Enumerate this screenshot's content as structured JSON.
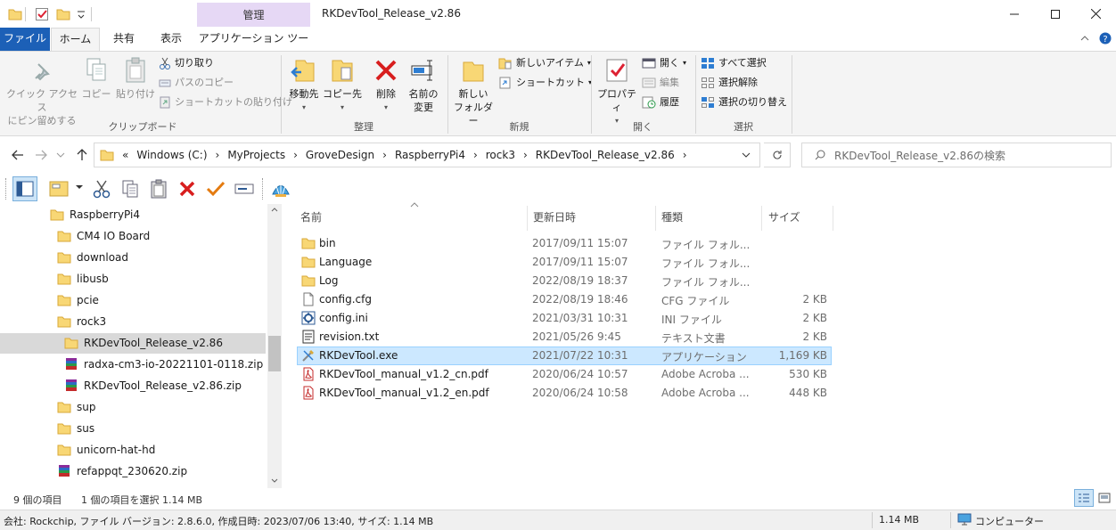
{
  "window": {
    "title": "RKDevTool_Release_v2.86",
    "context_tab_group": "管理"
  },
  "ribbon_tabs": [
    {
      "label": "ファイル"
    },
    {
      "label": "ホーム"
    },
    {
      "label": "共有"
    },
    {
      "label": "表示"
    },
    {
      "label": "アプリケーション ツール"
    }
  ],
  "ribbon": {
    "clipboard": {
      "label": "クリップボード",
      "pin_line1": "クイック アクセス",
      "pin_line2": "にピン留めする",
      "copy": "コピー",
      "paste": "貼り付け",
      "cut": "切り取り",
      "copy_path": "パスのコピー",
      "paste_shortcut": "ショートカットの貼り付け"
    },
    "organize": {
      "label": "整理",
      "move_to": "移動先",
      "copy_to": "コピー先",
      "delete": "削除",
      "rename_line1": "名前の",
      "rename_line2": "変更"
    },
    "new": {
      "label": "新規",
      "new_folder_line1": "新しい",
      "new_folder_line2": "フォルダー",
      "new_item": "新しいアイテム",
      "shortcut": "ショートカット"
    },
    "open": {
      "label": "開く",
      "properties": "プロパティ",
      "open": "開く",
      "edit": "編集",
      "history": "履歴"
    },
    "select": {
      "label": "選択",
      "select_all": "すべて選択",
      "select_none": "選択解除",
      "invert": "選択の切り替え"
    }
  },
  "address": {
    "prefix": "«",
    "crumbs": [
      "Windows (C:)",
      "MyProjects",
      "GroveDesign",
      "RaspberryPi4",
      "rock3",
      "RKDevTool_Release_v2.86"
    ],
    "search_placeholder": "RKDevTool_Release_v2.86の検索"
  },
  "tree": [
    {
      "label": "RaspberryPi4",
      "icon": "folder"
    },
    {
      "label": "CM4 IO Board",
      "icon": "folder"
    },
    {
      "label": "download",
      "icon": "folder"
    },
    {
      "label": "libusb",
      "icon": "folder"
    },
    {
      "label": "pcie",
      "icon": "folder"
    },
    {
      "label": "rock3",
      "icon": "folder"
    },
    {
      "label": "RKDevTool_Release_v2.86",
      "icon": "folder",
      "selected": true
    },
    {
      "label": "radxa-cm3-io-20221101-0118.zip",
      "icon": "archive"
    },
    {
      "label": "RKDevTool_Release_v2.86.zip",
      "icon": "archive"
    },
    {
      "label": "sup",
      "icon": "folder"
    },
    {
      "label": "sus",
      "icon": "folder"
    },
    {
      "label": "unicorn-hat-hd",
      "icon": "folder"
    },
    {
      "label": "refappqt_230620.zip",
      "icon": "archive"
    }
  ],
  "columns": {
    "name": "名前",
    "date": "更新日時",
    "type": "種類",
    "size": "サイズ"
  },
  "files": [
    {
      "name": "bin",
      "date": "2017/09/11 15:07",
      "type": "ファイル フォル...",
      "size": "",
      "icon": "folder"
    },
    {
      "name": "Language",
      "date": "2017/09/11 15:07",
      "type": "ファイル フォル...",
      "size": "",
      "icon": "folder"
    },
    {
      "name": "Log",
      "date": "2022/08/19 18:37",
      "type": "ファイル フォル...",
      "size": "",
      "icon": "folder"
    },
    {
      "name": "config.cfg",
      "date": "2022/08/19 18:46",
      "type": "CFG ファイル",
      "size": "2 KB",
      "icon": "file"
    },
    {
      "name": "config.ini",
      "date": "2021/03/31 10:31",
      "type": "INI ファイル",
      "size": "2 KB",
      "icon": "ini"
    },
    {
      "name": "revision.txt",
      "date": "2021/05/26 9:45",
      "type": "テキスト文書",
      "size": "2 KB",
      "icon": "txt"
    },
    {
      "name": "RKDevTool.exe",
      "date": "2021/07/22 10:31",
      "type": "アプリケーション",
      "size": "1,169 KB",
      "icon": "exe",
      "selected": true
    },
    {
      "name": "RKDevTool_manual_v1.2_cn.pdf",
      "date": "2020/06/24 10:57",
      "type": "Adobe Acroba ...",
      "size": "530 KB",
      "icon": "pdf"
    },
    {
      "name": "RKDevTool_manual_v1.2_en.pdf",
      "date": "2020/06/24 10:58",
      "type": "Adobe Acroba ...",
      "size": "448 KB",
      "icon": "pdf"
    }
  ],
  "status": {
    "item_count": "9 個の項目",
    "selection": "1 個の項目を選択  1.14 MB"
  },
  "bottom_bar": {
    "details": "会社: Rockchip, ファイル バージョン: 2.8.6.0, 作成日時: 2023/07/06 13:40, サイズ: 1.14 MB",
    "size": "1.14 MB",
    "location": "コンピューター"
  },
  "colors": {
    "file_tab": "#1c60b7",
    "context_tab": "#e6d8f5",
    "selection_bg": "#cce8ff",
    "folder": "#f8d775"
  }
}
